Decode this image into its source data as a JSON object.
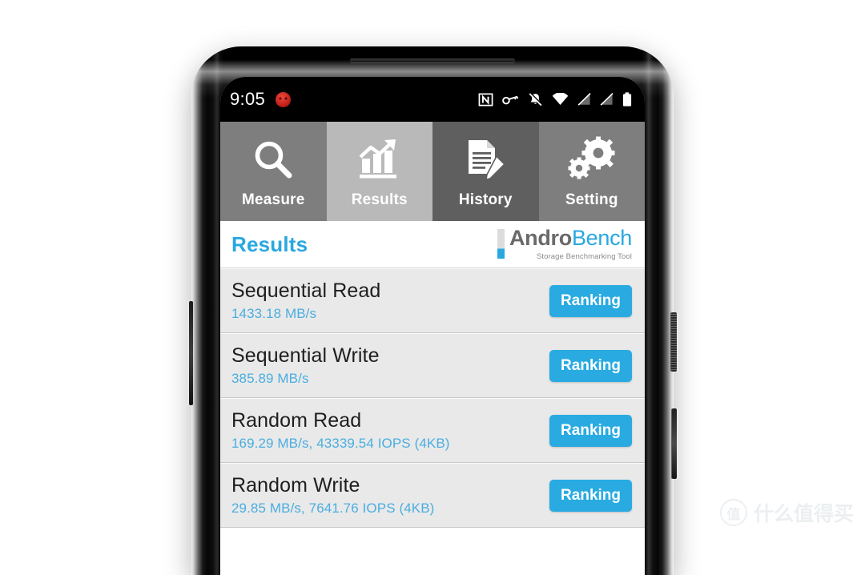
{
  "statusbar": {
    "time": "9:05",
    "notification_icon": "red-app-notification-icon",
    "icons": [
      "nfc-icon",
      "vpn-key-icon",
      "notifications-muted-icon",
      "wifi-icon",
      "signal-no-sim-1-icon",
      "signal-no-sim-2-icon",
      "battery-icon"
    ]
  },
  "tabs": [
    {
      "label": "Measure",
      "icon": "magnifier-icon",
      "active": false
    },
    {
      "label": "Results",
      "icon": "bar-chart-arrow-icon",
      "active": true
    },
    {
      "label": "History",
      "icon": "document-pencil-icon",
      "active": false
    },
    {
      "label": "Setting",
      "icon": "gears-icon",
      "active": false
    }
  ],
  "header": {
    "title": "Results",
    "logo": {
      "brand_first": "Andro",
      "brand_second": "Bench",
      "tagline": "Storage Benchmarking Tool"
    }
  },
  "results": {
    "rows": [
      {
        "title": "Sequential Read",
        "value": "1433.18 MB/s",
        "button": "Ranking"
      },
      {
        "title": "Sequential Write",
        "value": "385.89 MB/s",
        "button": "Ranking"
      },
      {
        "title": "Random Read",
        "value": "169.29 MB/s, 43339.54 IOPS (4KB)",
        "button": "Ranking"
      },
      {
        "title": "Random Write",
        "value": "29.85 MB/s, 7641.76 IOPS (4KB)",
        "button": "Ranking"
      }
    ]
  },
  "watermark": {
    "mark": "值",
    "text": "什么值得买"
  },
  "colors": {
    "accent_blue": "#29abe2",
    "value_blue": "#4aaee0",
    "title_blue": "#29a7e0",
    "tab_inactive": "#7e7e7e",
    "tab_active": "#b9b9b9",
    "tab_history": "#5f5f5f",
    "row_bg": "#e9e9e9"
  }
}
